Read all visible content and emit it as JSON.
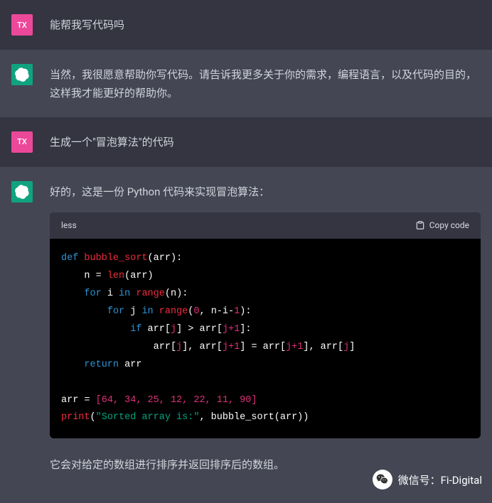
{
  "messages": [
    {
      "role": "user",
      "avatar_text": "TX",
      "text": "能帮我写代码吗"
    },
    {
      "role": "assistant",
      "text": "当然，我很愿意帮助你写代码。请告诉我更多关于你的需求，编程语言，以及代码的目的，这样我才能更好的帮助你。"
    },
    {
      "role": "user",
      "avatar_text": "TX",
      "text": "生成一个\"冒泡算法\"的代码"
    },
    {
      "role": "assistant",
      "intro": "好的，这是一份 Python 代码来实现冒泡算法：",
      "after": "它会对给定的数组进行排序并返回排序后的数组。"
    }
  ],
  "code": {
    "lang_label": "less",
    "copy_label": "Copy code",
    "tokens": {
      "def": "def",
      "func_name": "bubble_sort",
      "arr": "arr",
      "n_assign": "n = ",
      "len": "len",
      "for": "for",
      "i": "i",
      "j": "j",
      "in": "in",
      "range": "range",
      "n_var": "n",
      "zero": "0",
      "nmi1": "n-i-",
      "one": "1",
      "if": "if",
      "jplus1": "j+1",
      "return": "return",
      "arr_data": "[64, 34, 25, 12, 22, 11, 90]",
      "print": "print",
      "sorted_str": "\"Sorted array is:\""
    }
  },
  "watermark": {
    "label": "微信号：Fi-Digital"
  }
}
